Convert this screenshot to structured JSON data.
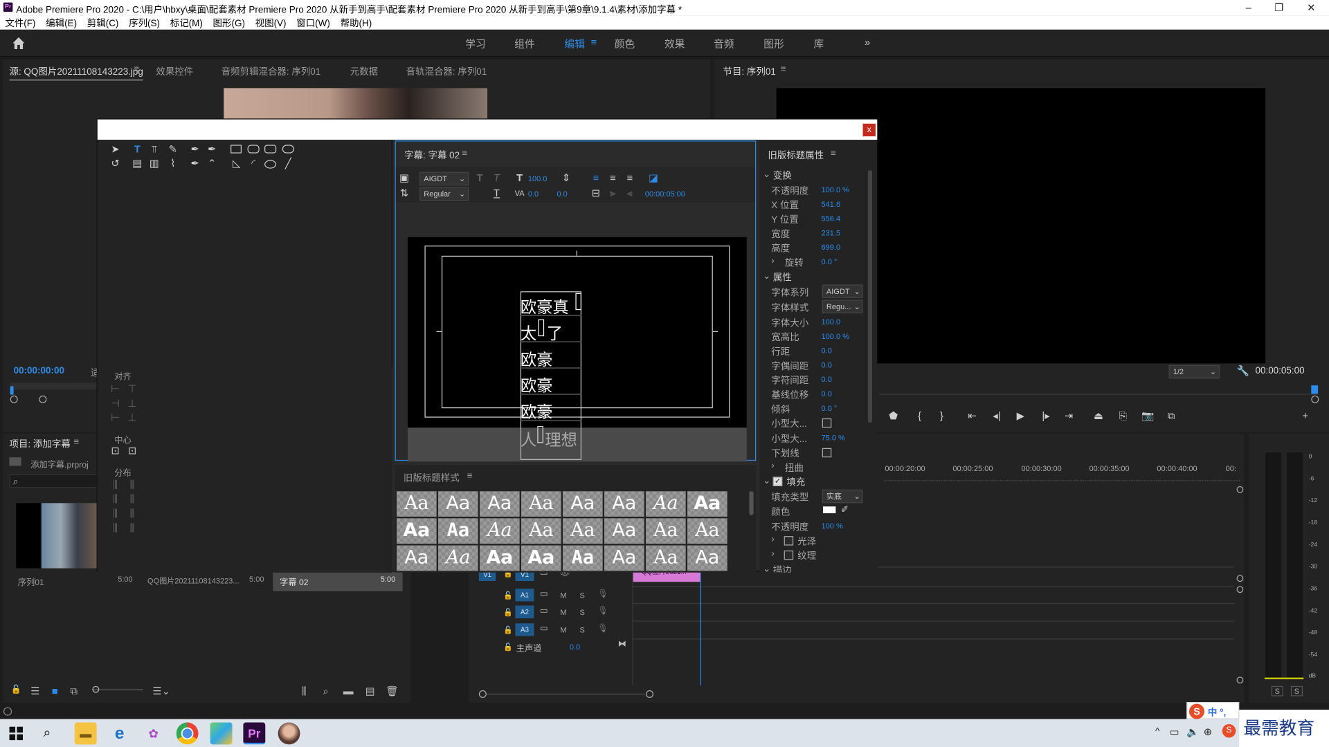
{
  "window": {
    "title": "Adobe Premiere Pro 2020 - C:\\用户\\hbxy\\桌面\\配套素材 Premiere Pro 2020 从新手到高手\\配套素材 Premiere Pro 2020 从新手到高手\\第9章\\9.1.4\\素材\\添加字幕 *",
    "min": "–",
    "max": "❐",
    "close": "✕"
  },
  "menu": [
    "文件(F)",
    "编辑(E)",
    "剪辑(C)",
    "序列(S)",
    "标记(M)",
    "图形(G)",
    "视图(V)",
    "窗口(W)",
    "帮助(H)"
  ],
  "workspaces": {
    "items": [
      "学习",
      "组件",
      "编辑",
      "颜色",
      "效果",
      "音频",
      "图形",
      "库"
    ],
    "active": "编辑",
    "more": "»"
  },
  "source_panel": {
    "tabs": [
      "源: QQ图片20211108143223.jpg",
      "效果控件",
      "音频剪辑混合器: 序列01",
      "元数据",
      "音轨混合器: 序列01"
    ],
    "timecode": "00:00:00:00"
  },
  "program_panel": {
    "title": "节目: 序列01",
    "zoom": "1/2",
    "timecode": "00:00:05:00"
  },
  "title_dialog": {
    "close": "x",
    "title_tab": "字幕: 字幕 02",
    "font_family": "AIGDT",
    "font_style": "Regular",
    "font_size": "100.0",
    "tracking": "0.0",
    "leading": "0.0",
    "timecode": "00:00:05:00",
    "canvas_lines": [
      "欧豪真",
      "太",
      "了",
      "欧豪",
      "欧豪",
      "欧豪",
      "人",
      "理想"
    ],
    "align_label": "对齐",
    "center_label": "中心",
    "distribute_label": "分布",
    "styles_tab": "旧版标题样式",
    "styles": [
      "Aa",
      "Aa",
      "Aa",
      "Aa",
      "Aa",
      "Aa",
      "Aa",
      "Aa",
      "Aa",
      "Aa",
      "Aa",
      "Aa",
      "Aa",
      "Aa",
      "Aa",
      "Aa",
      "Aa",
      "Aa",
      "Aa",
      "Aa",
      "Aa",
      "Aa",
      "Aa",
      "Aa"
    ],
    "props_tab": "旧版标题属性",
    "props": {
      "transform": "变换",
      "opacity_label": "不透明度",
      "opacity": "100.0 %",
      "x_label": "X 位置",
      "x": "541.6",
      "y_label": "Y 位置",
      "y": "556.4",
      "width_label": "宽度",
      "width": "231.5",
      "height_label": "高度",
      "height": "699.0",
      "rotation_label": "旋转",
      "rotation": "0.0 °",
      "attributes": "属性",
      "family_label": "字体系列",
      "family": "AIGDT",
      "style_label": "字体样式",
      "style": "Regu...",
      "size_label": "字体大小",
      "size": "100.0",
      "aspect_label": "宽高比",
      "aspect": "100.0 %",
      "leading_label": "行距",
      "leading": "0.0",
      "kerning_label": "字偶间距",
      "kerning": "0.0",
      "tracking_label": "字符间距",
      "tracking": "0.0",
      "baseline_label": "基线位移",
      "baseline": "0.0",
      "slant_label": "倾斜",
      "slant": "0.0 °",
      "smallcaps_label": "小型大...",
      "smallcaps_size_label": "小型大...",
      "smallcaps_size": "75.0 %",
      "underline_label": "下划线",
      "distort_label": "扭曲",
      "fill_label": "填充",
      "fill_type_label": "填充类型",
      "fill_type": "实底",
      "color_label": "颜色",
      "fill_opacity_label": "不透明度",
      "fill_opacity": "100 %",
      "sheen_label": "光泽",
      "texture_label": "纹理",
      "stroke_label": "描边"
    }
  },
  "project_panel": {
    "title": "项目: 添加字幕",
    "file": "添加字幕.prproj",
    "items": [
      {
        "name": "序列01",
        "dur": "5:00"
      },
      {
        "name": "QQ图片20211108143223...",
        "dur": "5:00"
      },
      {
        "name": "字幕 02",
        "dur": "5:00"
      }
    ]
  },
  "timeline": {
    "ruler": [
      "00:00:20:00",
      "00:00:25:00",
      "00:00:30:00",
      "00:00:35:00",
      "00:00:40:00",
      "00:"
    ],
    "tracks": [
      {
        "label": "V1",
        "src": "V1"
      },
      {
        "label": "A1"
      },
      {
        "label": "A2"
      },
      {
        "label": "A3"
      }
    ],
    "master": "主声道",
    "master_val": "0.0",
    "clip": "QQ图片2021...",
    "m": "M",
    "s": "S"
  },
  "meter": {
    "scale": [
      "0",
      "-6",
      "-12",
      "-18",
      "-24",
      "-30",
      "-36",
      "-42",
      "-48",
      "-54",
      "dB"
    ],
    "s1": "S",
    "s2": "S"
  },
  "ime": "中 °,",
  "watermark": "最需教育",
  "accent": "#2d8ceb"
}
